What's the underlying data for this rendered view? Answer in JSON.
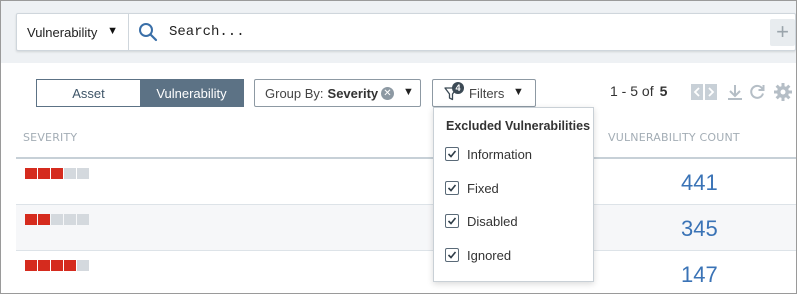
{
  "search": {
    "scope": "Vulnerability",
    "placeholder": "Search...",
    "add_label": "+"
  },
  "toolbar": {
    "toggle": {
      "asset": "Asset",
      "vulnerability": "Vulnerability",
      "selected": "Vulnerability"
    },
    "group_by": {
      "label": "Group By:",
      "value": "Severity"
    },
    "filters": {
      "label": "Filters",
      "badge": "4"
    },
    "paging": {
      "range": "1 - 5 of",
      "total": "5"
    }
  },
  "table": {
    "headers": {
      "severity": "SEVERITY",
      "count": "VULNERABILITY COUNT"
    },
    "rows": [
      {
        "severity_level": 3,
        "severity_max": 5,
        "count": "441"
      },
      {
        "severity_level": 2,
        "severity_max": 5,
        "count": "345"
      },
      {
        "severity_level": 4,
        "severity_max": 5,
        "count": "147"
      }
    ]
  },
  "filters_dropdown": {
    "title": "Excluded Vulnerabilities",
    "options": [
      {
        "label": "Information",
        "checked": true
      },
      {
        "label": "Fixed",
        "checked": true
      },
      {
        "label": "Disabled",
        "checked": true
      },
      {
        "label": "Ignored",
        "checked": true
      }
    ]
  },
  "colors": {
    "severity_on": "#d52b1e",
    "severity_off": "#d4d9de",
    "count_text": "#3a73b6",
    "toggle_active": "#5c7285"
  }
}
